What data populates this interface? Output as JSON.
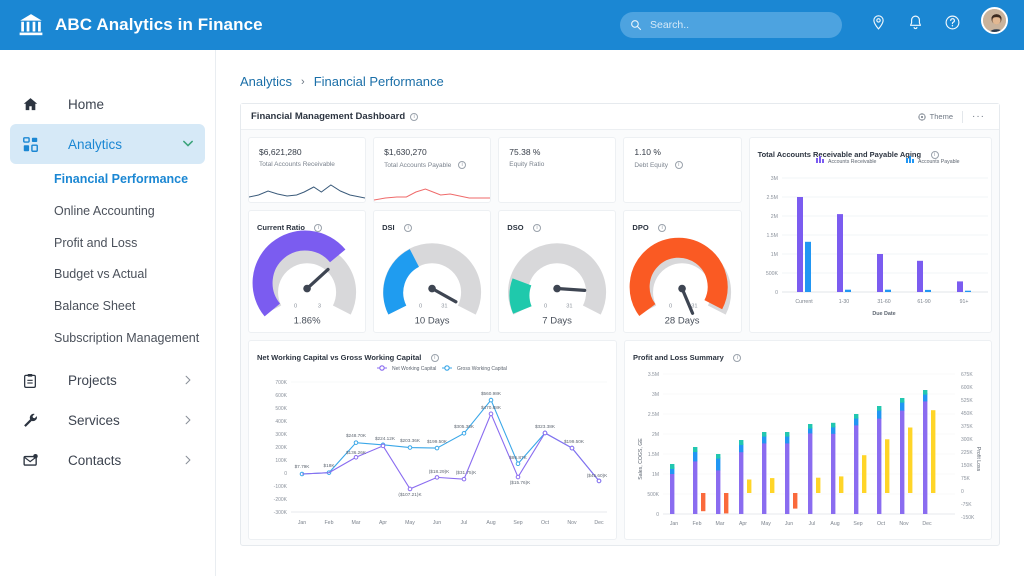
{
  "topbar": {
    "brand_title": "ABC Analytics in Finance",
    "brand_icon": "bank-icon",
    "search_placeholder": "Search..",
    "search_value": "",
    "icons": [
      "location-pin-icon",
      "bell-icon",
      "help-circle-icon",
      "avatar"
    ]
  },
  "sidebar": {
    "items": [
      {
        "label": "Home",
        "icon": "home-icon",
        "active": false,
        "expandable": false
      },
      {
        "label": "Analytics",
        "icon": "grid-icon",
        "active": true,
        "expandable": true
      },
      {
        "label": "Projects",
        "icon": "clipboard-icon",
        "active": false,
        "expandable": true
      },
      {
        "label": "Services",
        "icon": "wrench-icon",
        "active": false,
        "expandable": true
      },
      {
        "label": "Contacts",
        "icon": "contacts-icon",
        "active": false,
        "expandable": true
      }
    ],
    "sub_items": [
      {
        "label": "Financial Performance",
        "active": true
      },
      {
        "label": "Online Accounting",
        "active": false
      },
      {
        "label": "Profit and Loss",
        "active": false
      },
      {
        "label": "Budget vs Actual",
        "active": false
      },
      {
        "label": "Balance Sheet",
        "active": false
      },
      {
        "label": "Subscription Management",
        "active": false
      }
    ]
  },
  "breadcrumb": {
    "parent": "Analytics",
    "separator": "›",
    "current": "Financial Performance"
  },
  "panel": {
    "title": "Financial Management Dashboard",
    "theme_label": "Theme",
    "more_label": "···"
  },
  "kpis": [
    {
      "value": "$6,621,280",
      "label": "Total Accounts Receivable",
      "has_info": false,
      "color": "#3a5a7a"
    },
    {
      "value": "$1,630,270",
      "label": "Total Accounts Payable",
      "has_info": true,
      "color": "#ef6a6a"
    },
    {
      "value": "75.38 %",
      "label": "Equity Ratio",
      "has_info": false,
      "color": ""
    },
    {
      "value": "1.10 %",
      "label": "Debt Equity",
      "has_info": true,
      "color": ""
    }
  ],
  "gauges": [
    {
      "title": "Current Ratio",
      "value_label": "1.86%",
      "min": "0",
      "max": "3",
      "fraction": 0.62,
      "color": "#7b5cf0"
    },
    {
      "title": "DSI",
      "value_label": "10 Days",
      "min": "0",
      "max": "31",
      "fraction": 0.32,
      "color": "#1f9cf0"
    },
    {
      "title": "DSO",
      "value_label": "7 Days",
      "min": "0",
      "max": "31",
      "fraction": 0.22,
      "color": "#1fc9ac"
    },
    {
      "title": "DPO",
      "value_label": "28 Days",
      "min": "0",
      "max": "31",
      "fraction": 0.9,
      "color": "#fa5a23"
    }
  ],
  "chart_data": [
    {
      "type": "bar",
      "title": "Total Accounts Receivable and Payable Aging",
      "xlabel": "Due Date",
      "ylabel": "",
      "categories": [
        "Current",
        "1-30",
        "31-60",
        "61-90",
        "91+"
      ],
      "yticks": [
        "0",
        "500K",
        "1M",
        "1.5M",
        "2M",
        "2.5M",
        "3M"
      ],
      "ylim": [
        0,
        3000000
      ],
      "grid": true,
      "legend_position": "top",
      "series": [
        {
          "name": "Accounts Receivable",
          "color": "#7b5cf0",
          "values": [
            2500000,
            2050000,
            1000000,
            820000,
            280000
          ]
        },
        {
          "name": "Accounts Payable",
          "color": "#2196f3",
          "values": [
            1320000,
            60000,
            60000,
            55000,
            35000
          ]
        }
      ]
    },
    {
      "type": "line",
      "title": "Net Working Capital vs Gross Working Capital",
      "xlabel": "",
      "ylabel": "",
      "categories": [
        "Jan",
        "Feb",
        "Mar",
        "Apr",
        "May",
        "Jun",
        "Jul",
        "Aug",
        "Sep",
        "Oct",
        "Nov",
        "Dec"
      ],
      "yticks": [
        "-300K",
        "-200K",
        "-100K",
        "0",
        "100K",
        "200K",
        "300K",
        "400K",
        "500K",
        "600K",
        "700K"
      ],
      "ylim": [
        -300000,
        700000
      ],
      "grid": false,
      "legend_position": "top",
      "series": [
        {
          "name": "Net Working Capital",
          "color": "#8a6cf0",
          "values": [
            7790,
            18000,
            136260,
            224120,
            -107210,
            -18290,
            -31750,
            470880,
            -15760,
            323380,
            199500,
            -45600
          ],
          "labels": [
            "",
            "",
            "$136.26K",
            "$224.12K",
            "($107.21)K",
            "($18.29)K",
            "($31.75)K",
            "$470.88K",
            "($15.76)K",
            "$323.38K",
            "$199.50K",
            "($45.60)K"
          ]
        },
        {
          "name": "Gross Working Capital",
          "color": "#3aa7e8",
          "values": [
            7790,
            18000,
            248700,
            224120,
            203360,
            199500,
            305360,
            560980,
            86870,
            323380,
            199500,
            -45600
          ],
          "labels": [
            "$7.79K",
            "$18K",
            "$248.70K",
            "$224.12K",
            "$203.36K",
            "$199.50K",
            "$305.36K",
            "$560.98K",
            "$86.87K",
            "$323.38K",
            "$199.50K",
            "($45.60)K"
          ]
        }
      ]
    },
    {
      "type": "bar",
      "title": "Profit and Loss Summary",
      "xlabel": "",
      "ylabel": "Sales, COGS, GE",
      "ylabel_right": "Profit Loss",
      "categories": [
        "Jan",
        "Feb",
        "Mar",
        "Apr",
        "May",
        "Jun",
        "Jul",
        "Aug",
        "Sep",
        "Oct",
        "Nov",
        "Dec"
      ],
      "yticks": [
        "0",
        "500K",
        "1M",
        "1.5M",
        "2M",
        "2.5M",
        "3M",
        "3.5M"
      ],
      "ylim": [
        0,
        3500000
      ],
      "yticks_right": [
        "-150K",
        "-75K",
        "0",
        "75K",
        "150K",
        "225K",
        "300K",
        "375K",
        "450K",
        "525K",
        "600K",
        "675K"
      ],
      "ylim_right": [
        -150000,
        675000
      ],
      "grid": true,
      "legend_position": "none",
      "series": [
        {
          "name": "Sales",
          "color": "#2196f3",
          "values": [
            1180000,
            1650000,
            1420000,
            1760000,
            1970000,
            1970000,
            2170000,
            2200000,
            2400000,
            2600000,
            2800000,
            3000000
          ]
        },
        {
          "name": "COGS",
          "color": "#8a6cf0",
          "values": [
            500000,
            1330000,
            1100000,
            1560000,
            1780000,
            1780000,
            2030000,
            2020000,
            2230000,
            2400000,
            2600000,
            2830000
          ]
        },
        {
          "name": "GE",
          "color": "#22c7b0",
          "values": [
            970000,
            820000,
            560000,
            1000000,
            860000,
            830000,
            880000,
            870000,
            1060000,
            1190000,
            1270000,
            1330000
          ]
        },
        {
          "name": "Profit",
          "color": "#ffd528",
          "values": [
            0,
            0,
            0,
            78000,
            86000,
            0,
            88000,
            96000,
            218000,
            310000,
            378000,
            478000
          ]
        },
        {
          "name": "Loss",
          "color": "#fa6a3c",
          "values": [
            0,
            -105000,
            -135000,
            0,
            0,
            -90000,
            0,
            0,
            0,
            0,
            0,
            0
          ]
        }
      ]
    }
  ]
}
